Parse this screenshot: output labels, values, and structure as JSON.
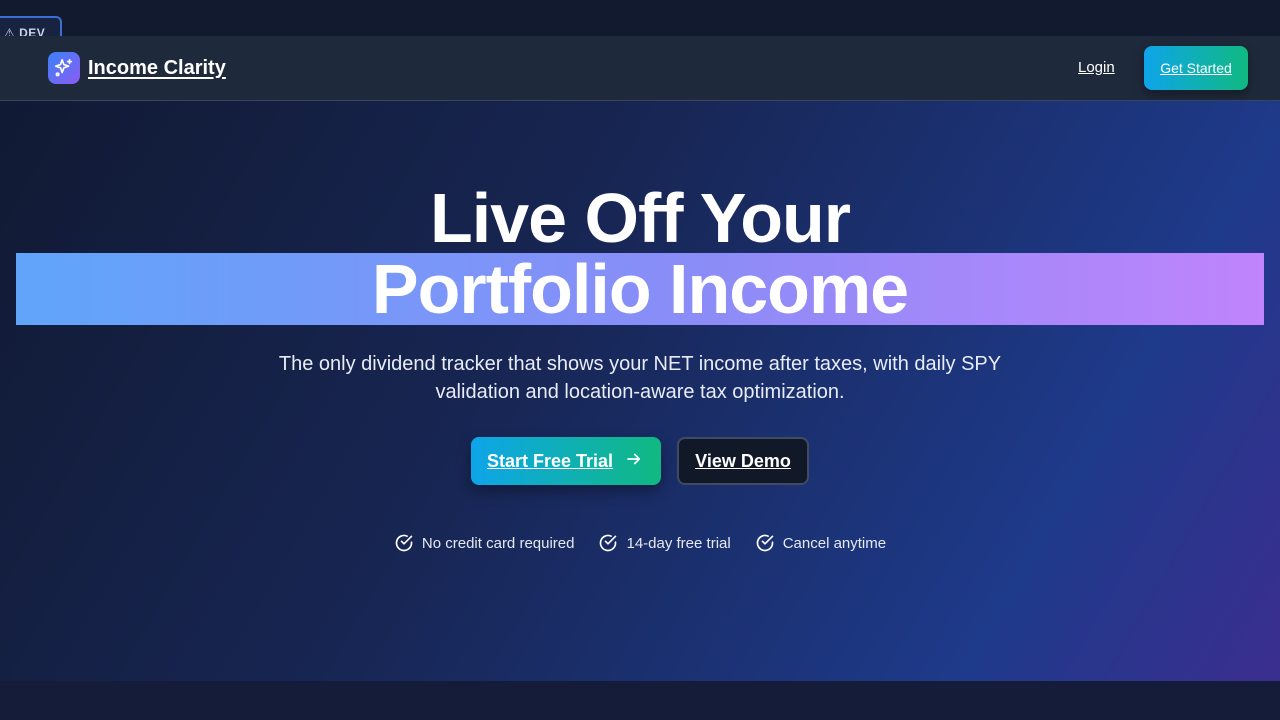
{
  "dev_badge": {
    "label": "⚠ DEV"
  },
  "navbar": {
    "brand_name": "Income Clarity",
    "login_label": "Login",
    "get_started_label": "Get Started"
  },
  "hero": {
    "headline_line1": "Live Off Your",
    "headline_line2": "Portfolio Income",
    "subtitle": "The only dividend tracker that shows your NET income after taxes, with daily SPY validation and location-aware tax optimization.",
    "primary_cta": "Start Free Trial",
    "secondary_cta": "View Demo",
    "perks": [
      {
        "label": "No credit card required",
        "icon": "check-circle-icon"
      },
      {
        "label": "14-day free trial",
        "icon": "check-circle-icon"
      },
      {
        "label": "Cancel anytime",
        "icon": "check-circle-icon"
      }
    ]
  },
  "colors": {
    "accent_gradient_start": "#0ea5e9",
    "accent_gradient_end": "#10b981",
    "headline_band_start": "#60a5fa",
    "headline_band_end": "#c084fc",
    "navbar_bg": "#1e293b"
  }
}
